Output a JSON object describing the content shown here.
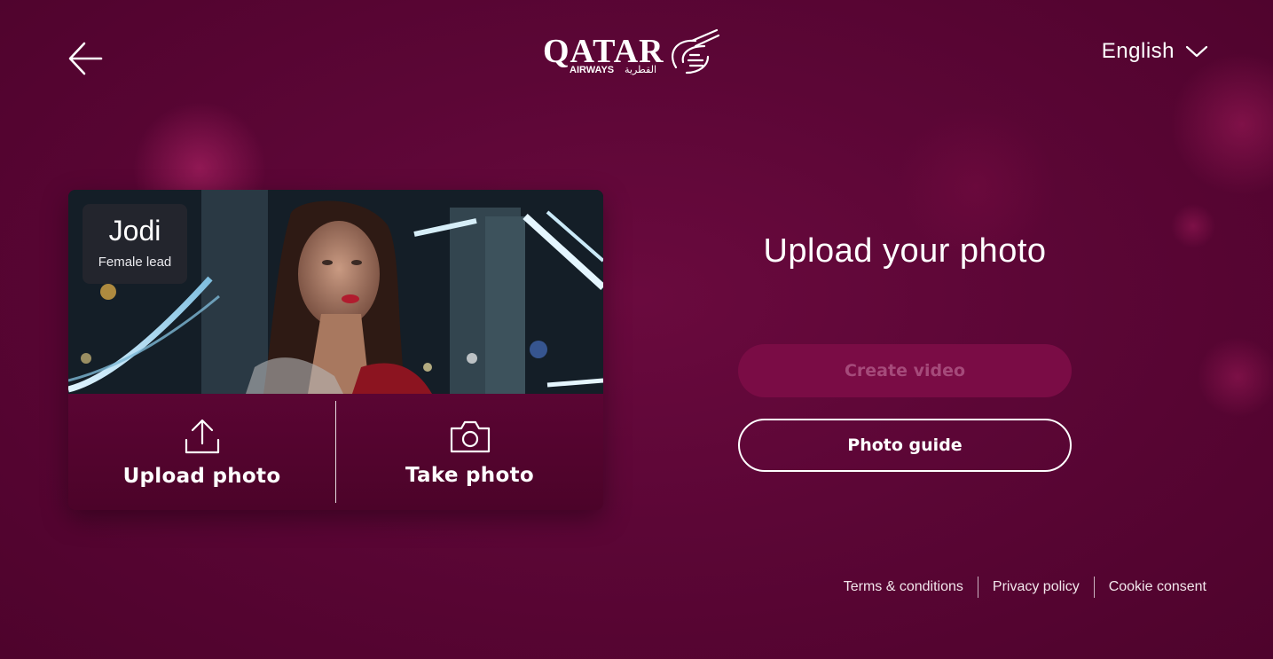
{
  "header": {
    "back_icon": "arrow-left-icon",
    "logo": {
      "brand": "QATAR",
      "sub": "AIRWAYS",
      "arabic": "القطرية"
    },
    "language": "English"
  },
  "card": {
    "character": {
      "name": "Jodi",
      "role": "Female lead"
    },
    "actions": [
      {
        "label": "Upload photo",
        "icon": "upload-icon"
      },
      {
        "label": "Take photo",
        "icon": "camera-icon"
      }
    ]
  },
  "main": {
    "title": "Upload your photo",
    "create_video_label": "Create video",
    "photo_guide_label": "Photo guide"
  },
  "footer": {
    "links": [
      "Terms & conditions",
      "Privacy policy",
      "Cookie consent"
    ]
  },
  "colors": {
    "background": "#5c0636",
    "create_button": "#7a0c45",
    "create_button_text": "#a54a7a"
  }
}
